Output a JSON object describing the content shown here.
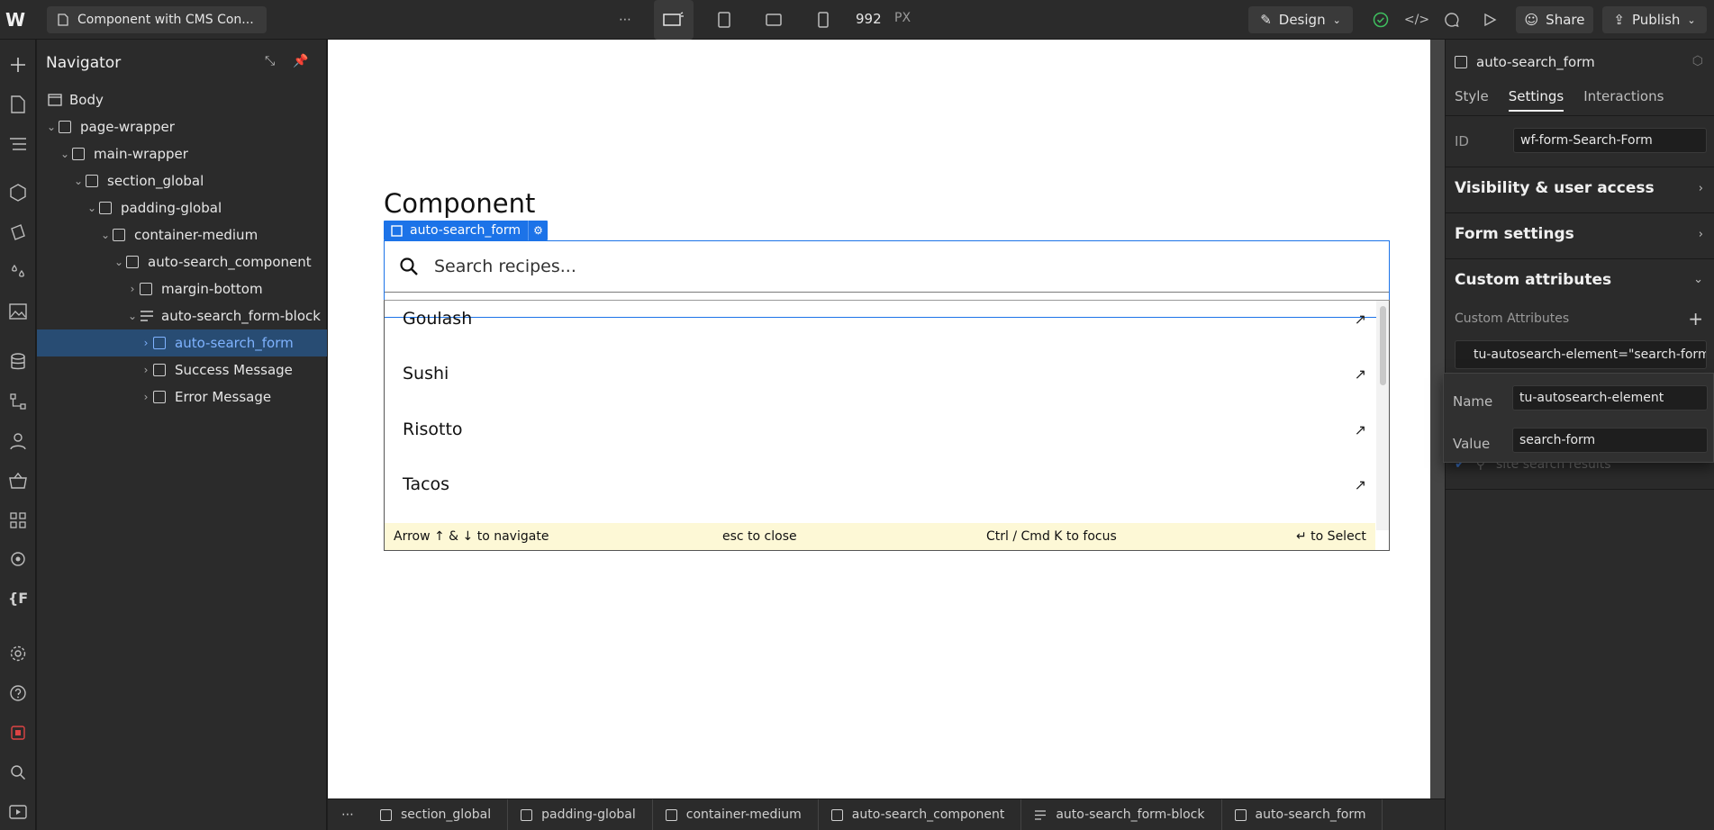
{
  "topbar": {
    "page_name": "Component with CMS Con...",
    "width_value": "992",
    "width_unit": "PX",
    "design_label": "Design",
    "share_label": "Share",
    "publish_label": "Publish"
  },
  "navigator": {
    "title": "Navigator",
    "items": [
      {
        "label": "Body",
        "type": "body"
      },
      {
        "label": "page-wrapper"
      },
      {
        "label": "main-wrapper"
      },
      {
        "label": "section_global"
      },
      {
        "label": "padding-global"
      },
      {
        "label": "container-medium"
      },
      {
        "label": "auto-search_component"
      },
      {
        "label": "margin-bottom"
      },
      {
        "label": "auto-search_form-block"
      },
      {
        "label": "auto-search_form"
      },
      {
        "label": "Success Message"
      },
      {
        "label": "Error Message"
      }
    ]
  },
  "canvas": {
    "heading": "Component",
    "selected_tag": "auto-search_form",
    "search_placeholder": "Search recipes...",
    "results": [
      "Goulash",
      "Sushi",
      "Risotto",
      "Tacos"
    ],
    "hints": {
      "navigate": "Arrow ↑ & ↓ to navigate",
      "close": "esc to close",
      "focus": "Ctrl / Cmd K to focus",
      "select": "↵ to Select"
    }
  },
  "breadcrumbs": [
    "section_global",
    "padding-global",
    "container-medium",
    "auto-search_component",
    "auto-search_form-block",
    "auto-search_form"
  ],
  "right_panel": {
    "element_name": "auto-search_form",
    "tabs": [
      "Style",
      "Settings",
      "Interactions"
    ],
    "active_tab": "Settings",
    "id_label": "ID",
    "id_value": "wf-form-Search-Form",
    "sections": {
      "visibility": "Visibility & user access",
      "form_settings": "Form settings",
      "custom_attributes": "Custom attributes"
    },
    "custom_attributes_sub": "Custom Attributes",
    "attribute_summary": "tu-autosearch-element=\"search-form\"",
    "popover": {
      "name_label": "Name",
      "name_value": "tu-autosearch-element",
      "value_label": "Value",
      "value_value": "search-form"
    },
    "site_search_label": "site search results"
  },
  "colors": {
    "accent": "#1c73e8",
    "selected_row": "#284c73",
    "hint_bg": "#fdf8d6",
    "panel_bg": "#2b2b2b",
    "publish_ok": "#3fbf5f"
  }
}
